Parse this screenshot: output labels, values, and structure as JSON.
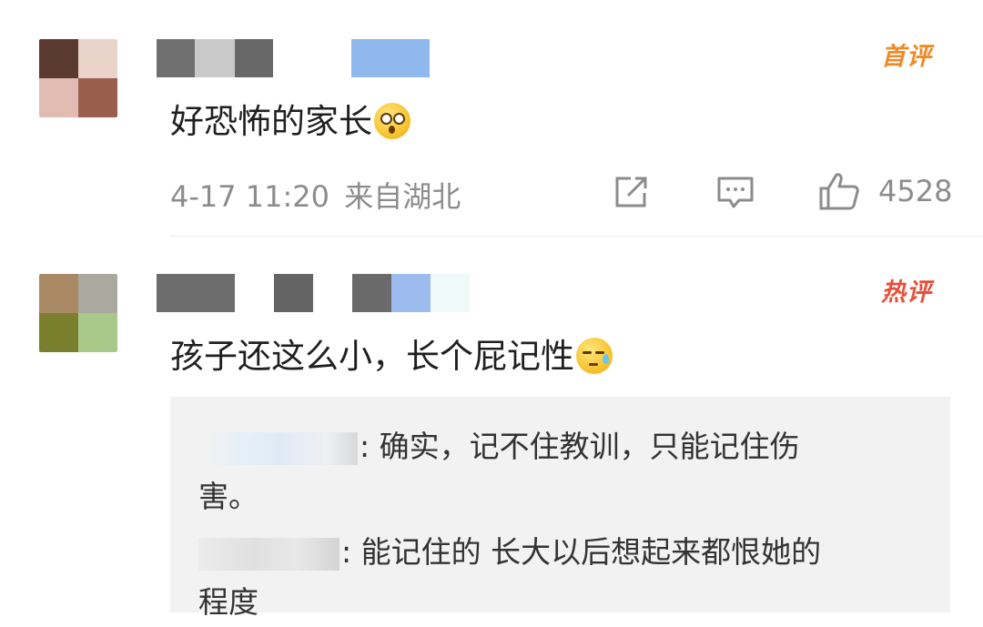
{
  "comments": [
    {
      "badge": "首评",
      "badge_color": "#f08a24",
      "text": "好恐怖的家长",
      "emoji": "flushed-emoji",
      "time": "4-17 11:20",
      "location": "来自湖北",
      "likes": "4528",
      "icons": [
        "share-icon",
        "reply-icon",
        "like-icon"
      ]
    },
    {
      "badge": "热评",
      "badge_color": "#e6503c",
      "text": "孩子还这么小，长个屁记性",
      "emoji": "sweat-emoji",
      "replies": [
        {
          "text_line1": ": 确实，记不住教训，只能记住伤",
          "text_line2": "害。"
        },
        {
          "text_line1": ": 能记住的 长大以后想起来都恨她的",
          "text_line2": "程度"
        }
      ]
    }
  ],
  "colors": {
    "meta_gray": "#8c8c8c",
    "reply_bg": "#f2f2f2"
  }
}
